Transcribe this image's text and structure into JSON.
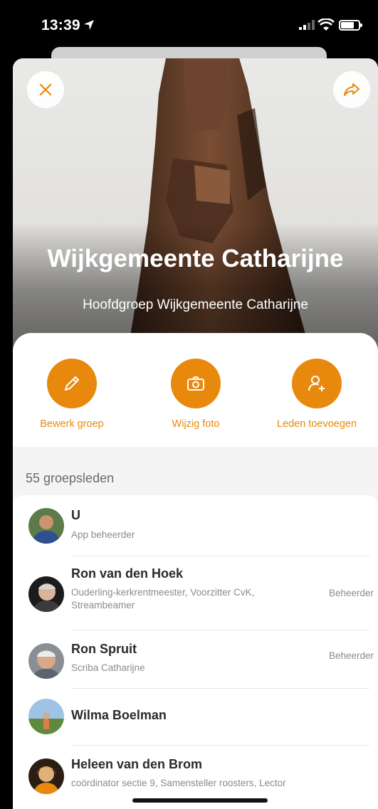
{
  "status_bar": {
    "time": "13:39"
  },
  "hero": {
    "title": "Wijkgemeente Catharijne",
    "subtitle": "Hoofdgroep Wijkgemeente Catharijne"
  },
  "actions": [
    {
      "label": "Bewerk groep",
      "icon": "pencil-icon"
    },
    {
      "label": "Wijzig foto",
      "icon": "camera-icon"
    },
    {
      "label": "Leden toevoegen",
      "icon": "add-user-icon"
    }
  ],
  "members_count": "55 groepsleden",
  "members": [
    {
      "name": "U",
      "role": "App beheerder",
      "badge": ""
    },
    {
      "name": "Ron van den Hoek",
      "role": "Ouderling-kerkrentmeester, Voorzitter CvK, Streambeamer",
      "badge": "Beheerder"
    },
    {
      "name": "Ron Spruit",
      "role": "Scriba Catharijne",
      "badge": "Beheerder"
    },
    {
      "name": "Wilma Boelman",
      "role": "",
      "badge": ""
    },
    {
      "name": "Heleen van den Brom",
      "role": "coördinator sectie 9, Samensteller roosters, Lector",
      "badge": ""
    }
  ],
  "colors": {
    "accent": "#e8890e",
    "background": "#f4f4f4"
  }
}
